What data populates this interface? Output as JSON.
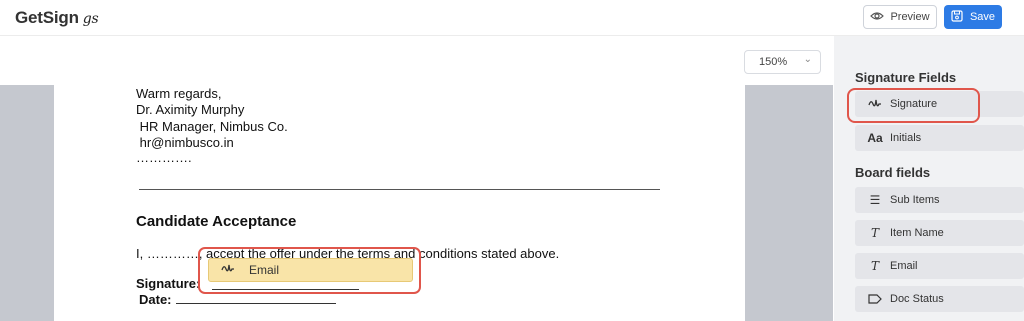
{
  "header": {
    "logo_text": "GetSign",
    "logo_mark": "gs",
    "preview_label": "Preview",
    "save_label": "Save"
  },
  "toolbar": {
    "zoom_value": "150%"
  },
  "document": {
    "lines": [
      "Warm regards,",
      "Dr. Aximity Murphy",
      " HR Manager, Nimbus Co.",
      " hr@nimbusco.in",
      "…………."
    ],
    "section_heading": "Candidate Acceptance",
    "acceptance_text": "I, …………, accept the offer under the terms and conditions stated above.",
    "signature_label": "Signature:",
    "date_label": "Date:"
  },
  "placed_field": {
    "label": "Email",
    "icon": "signature-wave-icon"
  },
  "sidebar": {
    "signature_fields_title": "Signature Fields",
    "signature_fields": [
      {
        "label": "Signature",
        "icon": "signature-wave-icon"
      },
      {
        "label": "Initials",
        "icon": "initials-icon"
      }
    ],
    "board_fields_title": "Board fields",
    "board_fields": [
      {
        "label": "Sub Items",
        "icon": "list-icon"
      },
      {
        "label": "Item Name",
        "icon": "text-format-icon"
      },
      {
        "label": "Email",
        "icon": "text-format-icon"
      },
      {
        "label": "Doc Status",
        "icon": "tag-icon"
      }
    ]
  },
  "colors": {
    "accent": "#2d7be5",
    "highlight": "#e0564b",
    "field_fill": "#f9e4a8"
  }
}
